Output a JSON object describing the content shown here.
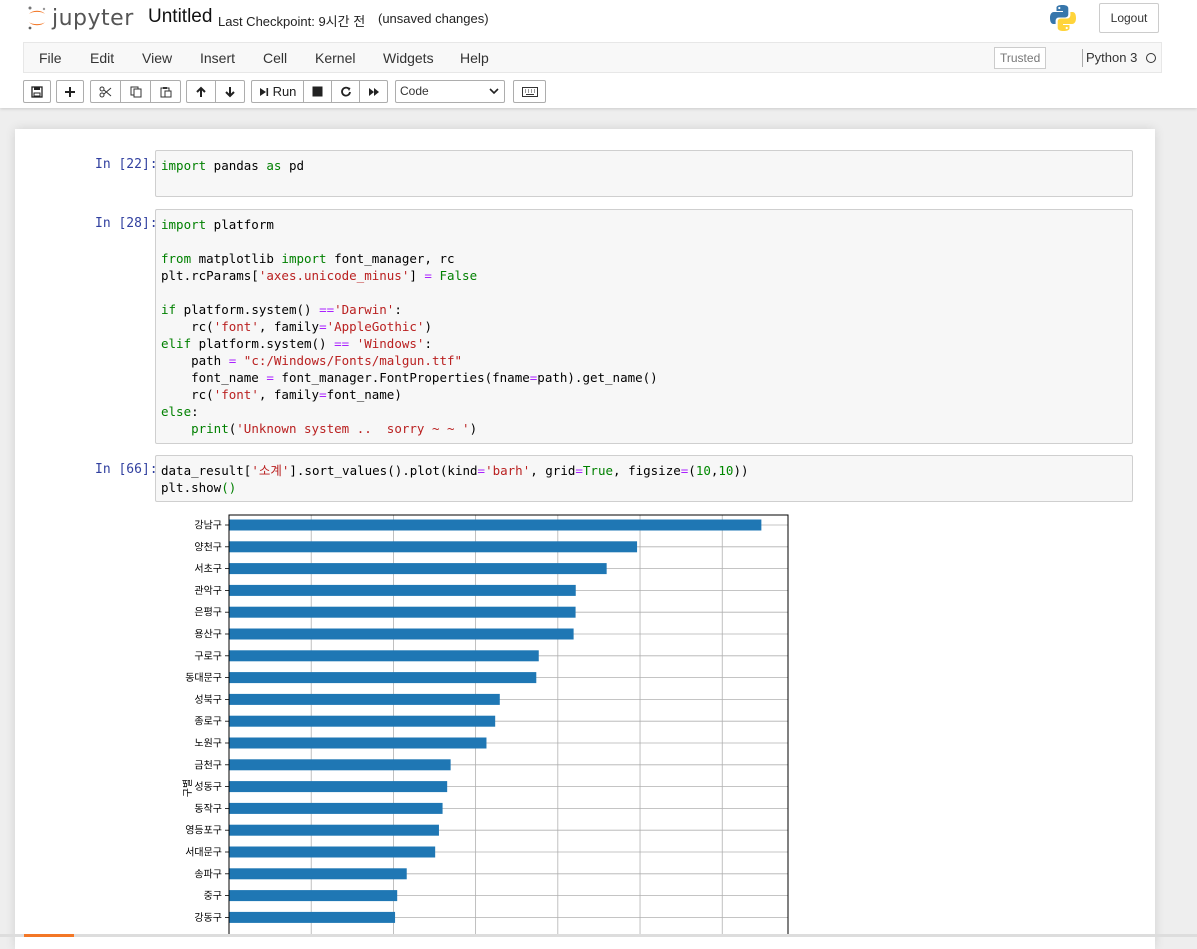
{
  "header": {
    "logo_text": "jupyter",
    "notebook_title": "Untitled",
    "checkpoint": "Last Checkpoint: 9시간 전",
    "autosave": "(unsaved changes)",
    "logout_label": "Logout"
  },
  "menu": {
    "items": [
      "File",
      "Edit",
      "View",
      "Insert",
      "Cell",
      "Kernel",
      "Widgets",
      "Help"
    ],
    "trusted": "Trusted",
    "kernel": "Python 3"
  },
  "toolbar": {
    "run_label": "Run",
    "cell_type": "Code"
  },
  "cells": [
    {
      "prompt": "In [22]:"
    },
    {
      "prompt": "In [28]:"
    },
    {
      "prompt": "In [66]:"
    }
  ],
  "colors": {
    "bar": "#1f77b4",
    "prompt": "#303f9f",
    "keyword": "#008000",
    "string": "#ba2121",
    "operator": "#aa22ff"
  },
  "chart_data": {
    "type": "bar",
    "orientation": "horizontal",
    "ylabel": "구별",
    "grid": true,
    "categories": [
      "강남구",
      "양천구",
      "서초구",
      "관악구",
      "은평구",
      "용산구",
      "구로구",
      "동대문구",
      "성북구",
      "종로구",
      "노원구",
      "금천구",
      "성동구",
      "동작구",
      "영등포구",
      "서대문구",
      "송파구",
      "중구",
      "강동구"
    ],
    "values": [
      3238,
      2482,
      2297,
      2109,
      2108,
      2096,
      1884,
      1869,
      1647,
      1619,
      1566,
      1348,
      1327,
      1299,
      1277,
      1254,
      1081,
      1023,
      1010
    ],
    "xlim": [
      0,
      3400
    ],
    "x_gridlines": [
      500,
      1000,
      1500,
      2000,
      2500,
      3000
    ]
  }
}
